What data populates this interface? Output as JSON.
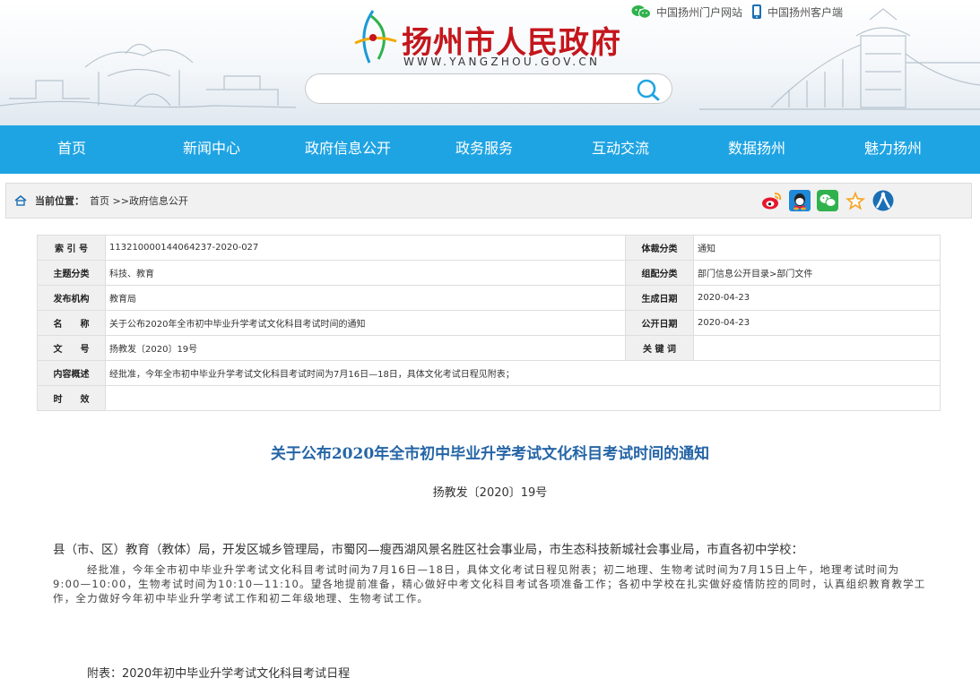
{
  "header": {
    "site_title": "扬州市人民政府",
    "site_url": "WWW.YANGZHOU.GOV.CN",
    "top_links": [
      "中国扬州门户网站",
      "中国扬州客户端"
    ],
    "search_placeholder": ""
  },
  "nav": {
    "items": [
      "首页",
      "新闻中心",
      "政府信息公开",
      "政务服务",
      "互动交流",
      "数据扬州",
      "魅力扬州"
    ]
  },
  "breadcrumb": {
    "label": "当前位置：",
    "items": [
      "首页",
      ">>",
      "政府信息公开"
    ]
  },
  "meta": {
    "index_label": "索 引 号",
    "index_value": "113210000144064237-2020-027",
    "genre_label": "体裁分类",
    "genre_value": "通知",
    "topic_label": "主题分类",
    "topic_value": "科技、教育",
    "group_label": "组配分类",
    "group_value": "部门信息公开目录>部门文件",
    "org_label": "发布机构",
    "org_value": "教育局",
    "created_label": "生成日期",
    "created_value": "2020-04-23",
    "name_label": "名　　称",
    "name_value": "关于公布2020年全市初中毕业升学考试文化科目考试时间的通知",
    "public_label": "公开日期",
    "public_value": "2020-04-23",
    "docno_label": "文　　号",
    "docno_value": "扬教发〔2020〕19号",
    "keyword_label": "关 键 词",
    "keyword_value": "",
    "summary_label": "内容概述",
    "summary_value": "经批准，今年全市初中毕业升学考试文化科目考试时间为7月16日—18日，具体文化考试日程见附表；",
    "validity_label": "时　　效",
    "validity_value": ""
  },
  "article": {
    "title": "关于公布2020年全市初中毕业升学考试文化科目考试时间的通知",
    "doc_no": "扬教发〔2020〕19号",
    "addressee": "县（市、区）教育（教体）局，开发区城乡管理局，市蜀冈—瘦西湖风景名胜区社会事业局，市生态科技新城社会事业局，市直各初中学校：",
    "body": "经批准，今年全市初中毕业升学考试文化科目考试时间为7月16日—18日，具体文化考试日程见附表；初二地理、生物考试时间为7月15日上午，地理考试时间为　9:00—10:00，生物考试时间为10:10—11:10。望各地提前准备，精心做好中考文化科目考试各项准备工作；各初中学校在扎实做好疫情防控的同时，认真组织教育教学工作，全力做好今年初中毕业升学考试工作和初二年级地理、生物考试工作。",
    "attachment": "附表：2020年初中毕业升学考试文化科目考试日程"
  }
}
